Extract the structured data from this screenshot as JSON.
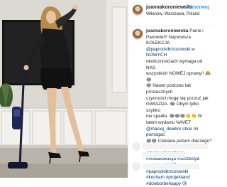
{
  "post": {
    "username": "joannakoroniewska",
    "follow_label": "Obserwuj",
    "separator": "•",
    "location": "Wilanów, Warszawa, Poland",
    "caption": {
      "username": "joannakoroniewska",
      "lines": [
        {
          "text": "Panie i",
          "link": false
        },
        {
          "text": "Panowie!!! Najnowsza KOLEKCJA",
          "link": false
        },
        {
          "text": "@paprockibrzozowski w NOWYCH",
          "link": true
        },
        {
          "text": "okolicznościach wymaga od NAS",
          "link": false
        },
        {
          "text": "wszystkich NOWEJ oprawy!! 🙈😂",
          "link": false
        },
        {
          "text": "😂 Nawet podczas tak prozaicznych",
          "link": false
        },
        {
          "text": "czynności mogę się poczuć jak",
          "link": false
        },
        {
          "text": "GWIAZDA. 😂 Obym tylko szybko",
          "link": false
        },
        {
          "text": "nie spadła. 😂😂😂👏👏 W",
          "link": false
        },
        {
          "text": "takim wydaniu NAVET",
          "link": false
        },
        {
          "text": "@maciej_dowbor chce mi pomagać",
          "link": true
        },
        {
          "text": "😂😂 Ciekawa jestem dlaczego? 😉",
          "link": false
        },
        {
          "text": "#mama #narobocie",
          "link": true
        },
        {
          "text": "#nowakolekcja #szczeciya",
          "link": true
        },
        {
          "text": "#mówiszMASZ #paprockibrzozowski",
          "link": true
        },
        {
          "text": "#kocham #projektanci",
          "link": true
        },
        {
          "text": "#dowborbehappy 😘",
          "link": true
        }
      ]
    }
  },
  "colors": {
    "link": "#003569",
    "follow": "#3897f0",
    "text": "#262626"
  },
  "icons": {
    "avatar": "profile-photo",
    "photo": "woman-vacuuming-living-room"
  }
}
